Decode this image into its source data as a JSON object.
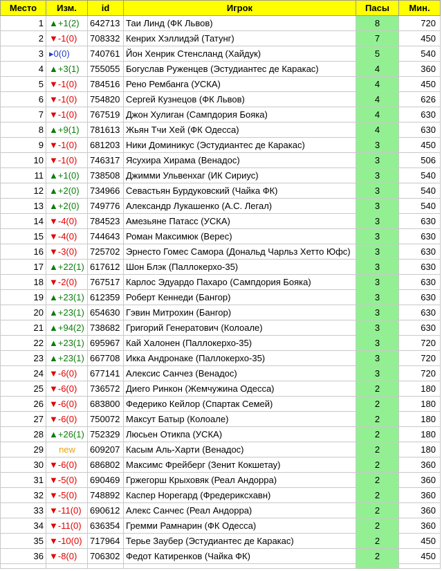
{
  "header": {
    "place": "Место",
    "change": "Изм.",
    "id": "id",
    "player": "Игрок",
    "assists": "Пасы",
    "minutes": "Мин."
  },
  "colors": {
    "header_bg": "#ffff00",
    "assists_bg": "#92f092",
    "up": "#0a7d0a",
    "down": "#e00000",
    "same": "#1f3fbf",
    "new": "#e8a317"
  },
  "rows": [
    {
      "place": "1",
      "dir": "up",
      "arrow": "▲",
      "change": "+1(2)",
      "id": "642713",
      "player": "Таи Линд (ФК Львов)",
      "assists": "8",
      "minutes": "720"
    },
    {
      "place": "2",
      "dir": "down",
      "arrow": "▼",
      "change": "-1(0)",
      "id": "708332",
      "player": "Кенрих Хэллидэй (Татунг)",
      "assists": "7",
      "minutes": "450"
    },
    {
      "place": "3",
      "dir": "same",
      "arrow": "▸",
      "change": "0(0)",
      "id": "740761",
      "player": "Йон Хенрик Стенсланд (Хайдук)",
      "assists": "5",
      "minutes": "540"
    },
    {
      "place": "4",
      "dir": "up",
      "arrow": "▲",
      "change": "+3(1)",
      "id": "755055",
      "player": "Богуслав Руженцев (Эстудиантес де Каракас)",
      "assists": "4",
      "minutes": "360"
    },
    {
      "place": "5",
      "dir": "down",
      "arrow": "▼",
      "change": "-1(0)",
      "id": "784516",
      "player": "Рено Рембанга (УСКА)",
      "assists": "4",
      "minutes": "450"
    },
    {
      "place": "6",
      "dir": "down",
      "arrow": "▼",
      "change": "-1(0)",
      "id": "754820",
      "player": "Сергей Кузнецов (ФК Львов)",
      "assists": "4",
      "minutes": "626"
    },
    {
      "place": "7",
      "dir": "down",
      "arrow": "▼",
      "change": "-1(0)",
      "id": "767519",
      "player": "Джон Хулиган (Сампдория Бояка)",
      "assists": "4",
      "minutes": "630"
    },
    {
      "place": "8",
      "dir": "up",
      "arrow": "▲",
      "change": "+9(1)",
      "id": "781613",
      "player": "Жьян Тчи Хей (ФК Одесса)",
      "assists": "4",
      "minutes": "630"
    },
    {
      "place": "9",
      "dir": "down",
      "arrow": "▼",
      "change": "-1(0)",
      "id": "681203",
      "player": "Ники Доминикус (Эстудиантес де Каракас)",
      "assists": "3",
      "minutes": "450"
    },
    {
      "place": "10",
      "dir": "down",
      "arrow": "▼",
      "change": "-1(0)",
      "id": "746317",
      "player": "Ясухира Хирама (Венадос)",
      "assists": "3",
      "minutes": "506"
    },
    {
      "place": "11",
      "dir": "up",
      "arrow": "▲",
      "change": "+1(0)",
      "id": "738508",
      "player": "Джимми Ульвенхаг (ИК Сириус)",
      "assists": "3",
      "minutes": "540"
    },
    {
      "place": "12",
      "dir": "up",
      "arrow": "▲",
      "change": "+2(0)",
      "id": "734966",
      "player": "Севастьян Бурдуковский (Чайка ФК)",
      "assists": "3",
      "minutes": "540"
    },
    {
      "place": "13",
      "dir": "up",
      "arrow": "▲",
      "change": "+2(0)",
      "id": "749776",
      "player": "Александр Лукашенко (А.С. Легал)",
      "assists": "3",
      "minutes": "540"
    },
    {
      "place": "14",
      "dir": "down",
      "arrow": "▼",
      "change": "-4(0)",
      "id": "784523",
      "player": "Амезьяне Патасс (УСКА)",
      "assists": "3",
      "minutes": "630"
    },
    {
      "place": "15",
      "dir": "down",
      "arrow": "▼",
      "change": "-4(0)",
      "id": "744643",
      "player": "Роман Максимюк (Верес)",
      "assists": "3",
      "minutes": "630"
    },
    {
      "place": "16",
      "dir": "down",
      "arrow": "▼",
      "change": "-3(0)",
      "id": "725702",
      "player": "Эрнесто Гомес Самора (Дональд Чарльз Хетто Юфс)",
      "assists": "3",
      "minutes": "630"
    },
    {
      "place": "17",
      "dir": "up",
      "arrow": "▲",
      "change": "+22(1)",
      "id": "617612",
      "player": "Шон Блэк (Паллокерхо-35)",
      "assists": "3",
      "minutes": "630"
    },
    {
      "place": "18",
      "dir": "down",
      "arrow": "▼",
      "change": "-2(0)",
      "id": "767517",
      "player": "Карлос Эдуардо Пахаро (Сампдория Бояка)",
      "assists": "3",
      "minutes": "630"
    },
    {
      "place": "19",
      "dir": "up",
      "arrow": "▲",
      "change": "+23(1)",
      "id": "612359",
      "player": "Роберт Кеннеди (Бангор)",
      "assists": "3",
      "minutes": "630"
    },
    {
      "place": "20",
      "dir": "up",
      "arrow": "▲",
      "change": "+23(1)",
      "id": "654630",
      "player": "Гэвин Митрохин (Бангор)",
      "assists": "3",
      "minutes": "630"
    },
    {
      "place": "21",
      "dir": "up",
      "arrow": "▲",
      "change": "+94(2)",
      "id": "738682",
      "player": "Григорий Генератович (Колоале)",
      "assists": "3",
      "minutes": "630"
    },
    {
      "place": "22",
      "dir": "up",
      "arrow": "▲",
      "change": "+23(1)",
      "id": "695967",
      "player": "Кай Халонен (Паллокерхо-35)",
      "assists": "3",
      "minutes": "720"
    },
    {
      "place": "23",
      "dir": "up",
      "arrow": "▲",
      "change": "+23(1)",
      "id": "667708",
      "player": "Икка Андронаке (Паллокерхо-35)",
      "assists": "3",
      "minutes": "720"
    },
    {
      "place": "24",
      "dir": "down",
      "arrow": "▼",
      "change": "-6(0)",
      "id": "677141",
      "player": "Алексис Санчез (Венадос)",
      "assists": "3",
      "minutes": "720"
    },
    {
      "place": "25",
      "dir": "down",
      "arrow": "▼",
      "change": "-6(0)",
      "id": "736572",
      "player": "Диего Ринкон (Жемчужина Одесса)",
      "assists": "2",
      "minutes": "180"
    },
    {
      "place": "26",
      "dir": "down",
      "arrow": "▼",
      "change": "-6(0)",
      "id": "683800",
      "player": "Федерико Кейлор (Спартак Семей)",
      "assists": "2",
      "minutes": "180"
    },
    {
      "place": "27",
      "dir": "down",
      "arrow": "▼",
      "change": "-6(0)",
      "id": "750072",
      "player": "Максут Батыр (Колоале)",
      "assists": "2",
      "minutes": "180"
    },
    {
      "place": "28",
      "dir": "up",
      "arrow": "▲",
      "change": "+26(1)",
      "id": "752329",
      "player": "Люсьен Отикпа (УСКА)",
      "assists": "2",
      "minutes": "180"
    },
    {
      "place": "29",
      "dir": "new",
      "arrow": "",
      "change": "new",
      "id": "609207",
      "player": "Касым Аль-Харти (Венадос)",
      "assists": "2",
      "minutes": "180"
    },
    {
      "place": "30",
      "dir": "down",
      "arrow": "▼",
      "change": "-6(0)",
      "id": "686802",
      "player": "Максимс Фрейберг (Зенит Кокшетау)",
      "assists": "2",
      "minutes": "360"
    },
    {
      "place": "31",
      "dir": "down",
      "arrow": "▼",
      "change": "-5(0)",
      "id": "690469",
      "player": "Гржегорш Крыховяк (Реал Андорра)",
      "assists": "2",
      "minutes": "360"
    },
    {
      "place": "32",
      "dir": "down",
      "arrow": "▼",
      "change": "-5(0)",
      "id": "748892",
      "player": "Каспер Норегард (Фредериксхавн)",
      "assists": "2",
      "minutes": "360"
    },
    {
      "place": "33",
      "dir": "down",
      "arrow": "▼",
      "change": "-11(0)",
      "id": "690612",
      "player": "Алекс Санчес (Реал Андорра)",
      "assists": "2",
      "minutes": "360"
    },
    {
      "place": "34",
      "dir": "down",
      "arrow": "▼",
      "change": "-11(0)",
      "id": "636354",
      "player": "Гремми Рамнарин (ФК Одесса)",
      "assists": "2",
      "minutes": "360"
    },
    {
      "place": "35",
      "dir": "down",
      "arrow": "▼",
      "change": "-10(0)",
      "id": "717964",
      "player": "Терье Заубер (Эстудиантес де Каракас)",
      "assists": "2",
      "minutes": "450"
    },
    {
      "place": "36",
      "dir": "down",
      "arrow": "▼",
      "change": "-8(0)",
      "id": "706302",
      "player": "Федот Катиренков (Чайка ФК)",
      "assists": "2",
      "minutes": "450"
    }
  ]
}
